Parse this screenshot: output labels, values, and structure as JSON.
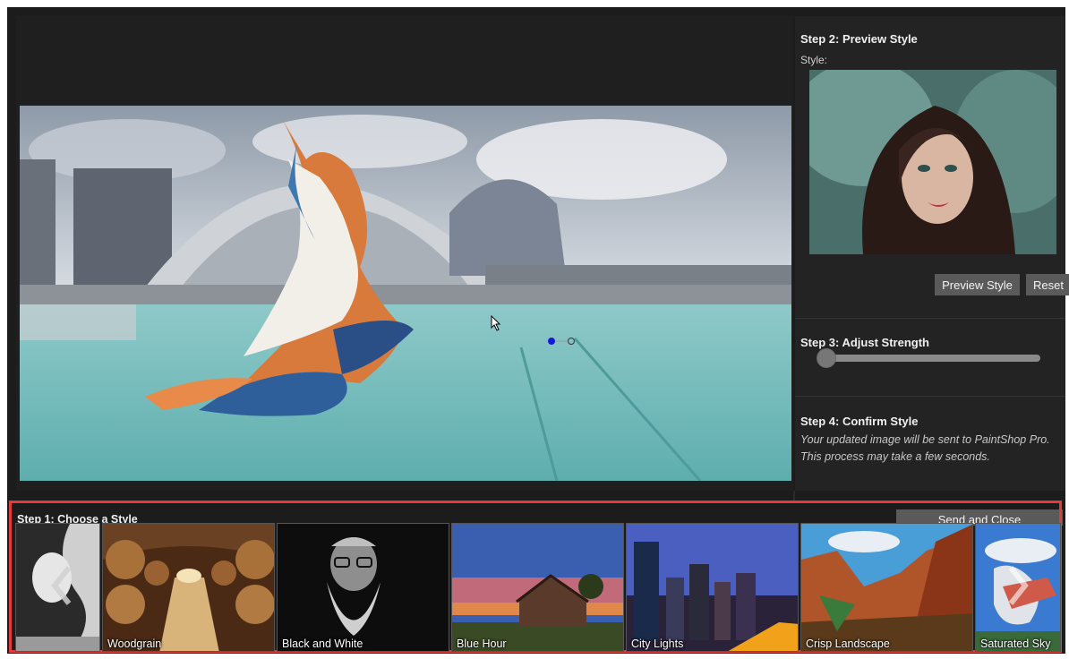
{
  "preview": {
    "compare_handle": "compare-handle"
  },
  "right_panel": {
    "step2_title": "Step 2: Preview Style",
    "style_label": "Style:",
    "preview_button": "Preview Style",
    "reset_button": "Reset",
    "step3_title": "Step 3: Adjust Strength",
    "strength_value": 0,
    "step4_title": "Step 4: Confirm Style",
    "confirm_text": "Your updated image will be sent to PaintShop Pro. This process may take a few seconds."
  },
  "bottom": {
    "step1_title": "Step 1: Choose a Style",
    "send_button": "Send and Close",
    "styles": [
      {
        "label": ""
      },
      {
        "label": "Woodgrain"
      },
      {
        "label": "Black and White"
      },
      {
        "label": "Blue Hour"
      },
      {
        "label": "City Lights"
      },
      {
        "label": "Crisp Landscape"
      },
      {
        "label": "Saturated Sky"
      }
    ],
    "nav": {
      "prev_icon": "chevron-left-icon",
      "next_icon": "chevron-right-icon"
    }
  },
  "colors": {
    "highlight": "#e23b3b",
    "background": "#1c1c1c",
    "button": "#5a5a5a"
  }
}
